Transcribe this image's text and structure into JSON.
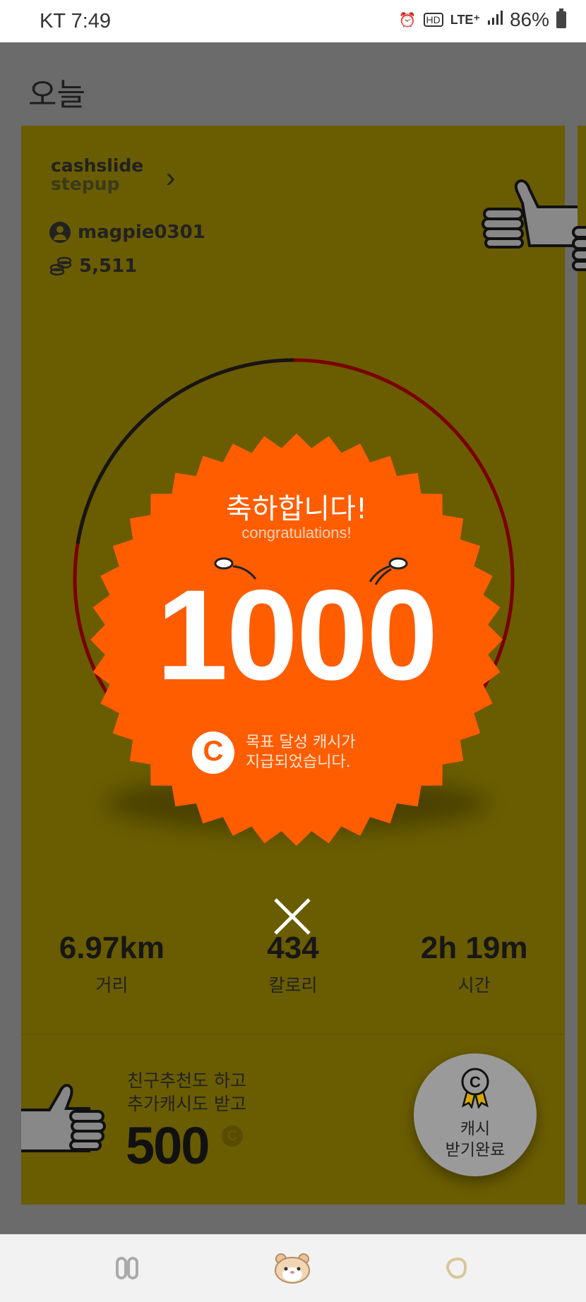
{
  "status_bar": {
    "carrier_time": "KT 7:49",
    "icons": [
      "alarm-icon",
      "hd-icon",
      "lte-icon",
      "signal-icon"
    ],
    "hd_label": "HD",
    "lte_label": "LTE⁺",
    "battery_text": "86%"
  },
  "page": {
    "title": "오늘"
  },
  "card": {
    "brand_line1": "cashslide",
    "brand_line2": "stepup",
    "username": "magpie0301",
    "coin_balance": "5,511",
    "colors": {
      "card": "#6a5c00",
      "badge": "#ff5d00"
    }
  },
  "badge": {
    "title": "축하합니다!",
    "subtitle": "congratulations!",
    "number": "1000",
    "message_line1": "목표 달성 캐시가",
    "message_line2": "지급되었습니다."
  },
  "stats": [
    {
      "value": "6.97km",
      "label": "거리"
    },
    {
      "value": "434",
      "label": "칼로리"
    },
    {
      "value": "2h 19m",
      "label": "시간"
    }
  ],
  "promo": {
    "line1": "친구추천도 하고",
    "line2": "추가캐시도 받고",
    "amount": "500",
    "currency_symbol": "C"
  },
  "reward_button": {
    "line1": "캐시",
    "line2": "받기완료"
  },
  "bottom_nav": {
    "items": [
      "shoes-icon",
      "hamster-icon",
      "chat-icon"
    ]
  }
}
